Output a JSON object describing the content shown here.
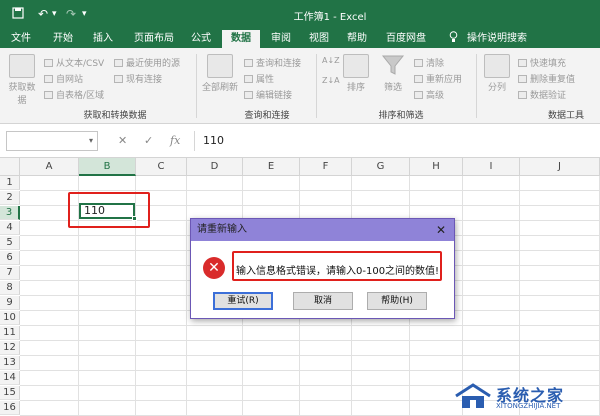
{
  "window": {
    "title": "工作簿1 - Excel",
    "undo_icon": "undo-icon",
    "redo_icon": "redo-icon",
    "save_icon": "save-icon",
    "undo_symbol": "↶",
    "redo_symbol": "↷",
    "menu_symbol": "▾"
  },
  "tabs": [
    "文件",
    "开始",
    "插入",
    "页面布局",
    "公式",
    "数据",
    "审阅",
    "视图",
    "帮助",
    "百度网盘",
    "操作说明搜索"
  ],
  "active_tab": "数据",
  "search_icon": "lightbulb-icon",
  "ribbon": {
    "get_data": "获取数据",
    "from_text_csv": "从文本/CSV",
    "from_web": "自网站",
    "from_table": "自表格/区域",
    "recent_sources": "最近使用的源",
    "existing_connections": "现有连接",
    "group_get_transform": "获取和转换数据",
    "refresh_all": "全部刷新",
    "queries_connections": "查询和连接",
    "properties": "属性",
    "edit_links": "编辑链接",
    "group_queries": "查询和连接",
    "sort_az": "A↓Z",
    "sort_za": "Z↓A",
    "sort": "排序",
    "filter": "筛选",
    "clear": "清除",
    "reapply": "重新应用",
    "advanced": "高级",
    "group_sort_filter": "排序和筛选",
    "split_columns": "分列",
    "flash_fill": "快速填充",
    "remove_duplicates": "删除重复值",
    "data_validation": "数据验证",
    "group_data_tools": "数据工具"
  },
  "formula_bar": {
    "cancel_symbol": "✕",
    "enter_symbol": "✓",
    "fx_symbol": "fx",
    "value": "110",
    "namebox_value": ""
  },
  "grid": {
    "columns": [
      "A",
      "B",
      "C",
      "D",
      "E",
      "F",
      "G",
      "H",
      "I",
      "J"
    ],
    "rows": [
      "1",
      "2",
      "3",
      "4",
      "5",
      "6",
      "7",
      "8",
      "9",
      "10",
      "11",
      "12",
      "13",
      "14",
      "15",
      "16"
    ],
    "selected_column": "B",
    "selected_row": "3",
    "active_cell_value": "110"
  },
  "dialog": {
    "title": "请重新输入",
    "close_symbol": "✕",
    "icon": "error-icon",
    "icon_symbol": "✕",
    "message": "输入信息格式错误，请输入0-100之间的数值!",
    "buttons": {
      "retry": "重试(R)",
      "cancel": "取消",
      "help": "帮助(H)"
    }
  },
  "watermark": {
    "text_cn": "系统之家",
    "text_en": "XITONGZHIJIA.NET"
  },
  "colors": {
    "excel_green": "#217346",
    "dialog_title": "#8f83d8",
    "error_red": "#d92b2b",
    "highlight_red": "#e0201c",
    "watermark_blue": "#2a5db0"
  }
}
